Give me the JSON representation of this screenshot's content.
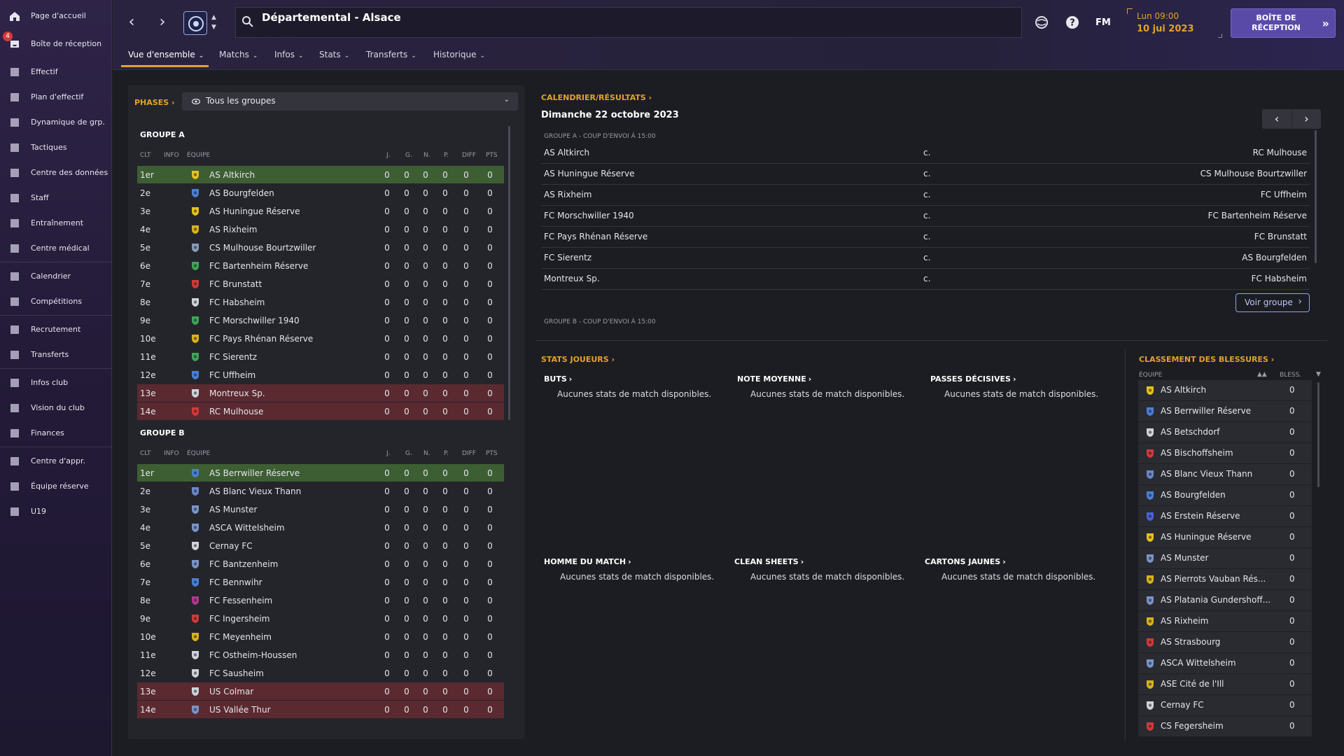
{
  "sidebar": {
    "items": [
      {
        "label": "Page d'accueil",
        "icon": "home-icon"
      },
      {
        "label": "Boîte de réception",
        "icon": "inbox-icon",
        "badge": "4"
      },
      {
        "label": "Effectif",
        "icon": "shirt-icon"
      },
      {
        "label": "Plan d'effectif",
        "icon": "clipboard-icon"
      },
      {
        "label": "Dynamique de grp.",
        "icon": "group-dynamics-icon"
      },
      {
        "label": "Tactiques",
        "icon": "tactics-icon"
      },
      {
        "label": "Centre des données",
        "icon": "data-hub-icon"
      },
      {
        "label": "Staff",
        "icon": "staff-icon"
      },
      {
        "label": "Entraînement",
        "icon": "training-icon"
      },
      {
        "label": "Centre médical",
        "icon": "medical-icon"
      },
      {
        "label": "Calendrier",
        "icon": "calendar-icon"
      },
      {
        "label": "Compétitions",
        "icon": "trophy-icon"
      },
      {
        "label": "Recrutement",
        "icon": "scouting-icon"
      },
      {
        "label": "Transferts",
        "icon": "transfers-icon"
      },
      {
        "label": "Infos club",
        "icon": "club-info-icon"
      },
      {
        "label": "Vision du club",
        "icon": "club-vision-icon"
      },
      {
        "label": "Finances",
        "icon": "finances-icon"
      },
      {
        "label": "Centre d'appr.",
        "icon": "youth-center-icon"
      },
      {
        "label": "Équipe réserve",
        "icon": "reserve-team-icon"
      },
      {
        "label": "U19",
        "icon": "u19-icon"
      }
    ]
  },
  "header": {
    "title": "Départemental - Alsace",
    "tabs": [
      "Vue d'ensemble",
      "Matchs",
      "Infos",
      "Stats",
      "Transferts",
      "Historique"
    ],
    "fm_label": "FM",
    "date_day": "Lun 09:00",
    "date_full": "10 jui 2023",
    "inbox_button": "BOÎTE DE RÉCEPTION"
  },
  "standings": {
    "phases_label": "PHASES",
    "filter_value": "Tous les groupes",
    "columns": [
      "CLT",
      "INFO",
      "ÉQUIPE",
      "J.",
      "G.",
      "N.",
      "P.",
      "DIFF",
      "PTS"
    ],
    "groups": [
      {
        "title": "GROUPE A",
        "rows": [
          {
            "pos": "1er",
            "team": "AS Altkirch",
            "stats": [
              "0",
              "0",
              "0",
              "0",
              "0",
              "0"
            ],
            "zone": "green",
            "crest": "#e8c21a"
          },
          {
            "pos": "2e",
            "team": "AS Bourgfelden",
            "stats": [
              "0",
              "0",
              "0",
              "0",
              "0",
              "0"
            ],
            "zone": "",
            "crest": "#4b7fd6"
          },
          {
            "pos": "3e",
            "team": "AS Huningue Réserve",
            "stats": [
              "0",
              "0",
              "0",
              "0",
              "0",
              "0"
            ],
            "zone": "",
            "crest": "#e8c21a"
          },
          {
            "pos": "4e",
            "team": "AS Rixheim",
            "stats": [
              "0",
              "0",
              "0",
              "0",
              "0",
              "0"
            ],
            "zone": "",
            "crest": "#d9b21c"
          },
          {
            "pos": "5e",
            "team": "CS Mulhouse Bourtzwiller",
            "stats": [
              "0",
              "0",
              "0",
              "0",
              "0",
              "0"
            ],
            "zone": "",
            "crest": "#8b9bb8"
          },
          {
            "pos": "6e",
            "team": "FC Bartenheim Réserve",
            "stats": [
              "0",
              "0",
              "0",
              "0",
              "0",
              "0"
            ],
            "zone": "",
            "crest": "#3fa55a"
          },
          {
            "pos": "7e",
            "team": "FC Brunstatt",
            "stats": [
              "0",
              "0",
              "0",
              "0",
              "0",
              "0"
            ],
            "zone": "",
            "crest": "#d23a3a"
          },
          {
            "pos": "8e",
            "team": "FC Habsheim",
            "stats": [
              "0",
              "0",
              "0",
              "0",
              "0",
              "0"
            ],
            "zone": "",
            "crest": "#cfd3da"
          },
          {
            "pos": "9e",
            "team": "FC Morschwiller 1940",
            "stats": [
              "0",
              "0",
              "0",
              "0",
              "0",
              "0"
            ],
            "zone": "",
            "crest": "#3fa55a"
          },
          {
            "pos": "10e",
            "team": "FC Pays Rhénan Réserve",
            "stats": [
              "0",
              "0",
              "0",
              "0",
              "0",
              "0"
            ],
            "zone": "",
            "crest": "#d9b21c"
          },
          {
            "pos": "11e",
            "team": "FC Sierentz",
            "stats": [
              "0",
              "0",
              "0",
              "0",
              "0",
              "0"
            ],
            "zone": "",
            "crest": "#3fa55a"
          },
          {
            "pos": "12e",
            "team": "FC Uffheim",
            "stats": [
              "0",
              "0",
              "0",
              "0",
              "0",
              "0"
            ],
            "zone": "",
            "crest": "#4b7fd6"
          },
          {
            "pos": "13e",
            "team": "Montreux Sp.",
            "stats": [
              "0",
              "0",
              "0",
              "0",
              "0",
              "0"
            ],
            "zone": "red",
            "crest": "#cfd3da"
          },
          {
            "pos": "14e",
            "team": "RC Mulhouse",
            "stats": [
              "0",
              "0",
              "0",
              "0",
              "0",
              "0"
            ],
            "zone": "red",
            "crest": "#d23a3a"
          }
        ]
      },
      {
        "title": "GROUPE B",
        "rows": [
          {
            "pos": "1er",
            "team": "AS Berrwiller Réserve",
            "stats": [
              "0",
              "0",
              "0",
              "0",
              "0",
              "0"
            ],
            "zone": "green",
            "crest": "#4b7fd6"
          },
          {
            "pos": "2e",
            "team": "AS Blanc Vieux Thann",
            "stats": [
              "0",
              "0",
              "0",
              "0",
              "0",
              "0"
            ],
            "zone": "",
            "crest": "#6b86c9"
          },
          {
            "pos": "3e",
            "team": "AS Munster",
            "stats": [
              "0",
              "0",
              "0",
              "0",
              "0",
              "0"
            ],
            "zone": "",
            "crest": "#7a94c8"
          },
          {
            "pos": "4e",
            "team": "ASCA Wittelsheim",
            "stats": [
              "0",
              "0",
              "0",
              "0",
              "0",
              "0"
            ],
            "zone": "",
            "crest": "#7a94c8"
          },
          {
            "pos": "5e",
            "team": "Cernay FC",
            "stats": [
              "0",
              "0",
              "0",
              "0",
              "0",
              "0"
            ],
            "zone": "",
            "crest": "#cfd3da"
          },
          {
            "pos": "6e",
            "team": "FC Bantzenheim",
            "stats": [
              "0",
              "0",
              "0",
              "0",
              "0",
              "0"
            ],
            "zone": "",
            "crest": "#7a94c8"
          },
          {
            "pos": "7e",
            "team": "FC Bennwihr",
            "stats": [
              "0",
              "0",
              "0",
              "0",
              "0",
              "0"
            ],
            "zone": "",
            "crest": "#4b7fd6"
          },
          {
            "pos": "8e",
            "team": "FC Fessenheim",
            "stats": [
              "0",
              "0",
              "0",
              "0",
              "0",
              "0"
            ],
            "zone": "",
            "crest": "#b03a8a"
          },
          {
            "pos": "9e",
            "team": "FC Ingersheim",
            "stats": [
              "0",
              "0",
              "0",
              "0",
              "0",
              "0"
            ],
            "zone": "",
            "crest": "#d23a3a"
          },
          {
            "pos": "10e",
            "team": "FC Meyenheim",
            "stats": [
              "0",
              "0",
              "0",
              "0",
              "0",
              "0"
            ],
            "zone": "",
            "crest": "#d9b21c"
          },
          {
            "pos": "11e",
            "team": "FC Ostheim-Houssen",
            "stats": [
              "0",
              "0",
              "0",
              "0",
              "0",
              "0"
            ],
            "zone": "",
            "crest": "#cfd3da"
          },
          {
            "pos": "12e",
            "team": "FC Sausheim",
            "stats": [
              "0",
              "0",
              "0",
              "0",
              "0",
              "0"
            ],
            "zone": "",
            "crest": "#cfd3da"
          },
          {
            "pos": "13e",
            "team": "US Colmar",
            "stats": [
              "0",
              "0",
              "0",
              "0",
              "0",
              "0"
            ],
            "zone": "red",
            "crest": "#cfd3da"
          },
          {
            "pos": "14e",
            "team": "US Vallée Thur",
            "stats": [
              "0",
              "0",
              "0",
              "0",
              "0",
              "0"
            ],
            "zone": "red",
            "crest": "#7a94c8"
          }
        ]
      }
    ]
  },
  "fixtures": {
    "header": "CALENDRIER/RÉSULTATS",
    "date": "Dimanche 22 octobre 2023",
    "group_a_label": "GROUPE A - COUP D'ENVOI À 15:00",
    "group_b_label": "GROUPE B - COUP D'ENVOI À 15:00",
    "vs": "c.",
    "matches": [
      {
        "home": "AS Altkirch",
        "away": "RC Mulhouse"
      },
      {
        "home": "AS Huningue Réserve",
        "away": "CS Mulhouse Bourtzwiller"
      },
      {
        "home": "AS Rixheim",
        "away": "FC Uffheim"
      },
      {
        "home": "FC Morschwiller 1940",
        "away": "FC Bartenheim Réserve"
      },
      {
        "home": "FC Pays Rhénan Réserve",
        "away": "FC Brunstatt"
      },
      {
        "home": "FC Sierentz",
        "away": "AS Bourgfelden"
      },
      {
        "home": "Montreux Sp.",
        "away": "FC Habsheim"
      }
    ],
    "view_group_button": "Voir groupe"
  },
  "player_stats": {
    "header": "STATS JOUEURS",
    "empty_text": "Aucunes stats de match disponibles.",
    "categories": [
      "BUTS",
      "NOTE MOYENNE",
      "PASSES DÉCISIVES",
      "HOMME DU MATCH",
      "CLEAN SHEETS",
      "CARTONS JAUNES"
    ]
  },
  "injuries": {
    "header": "CLASSEMENT DES BLESSURES",
    "col_team": "ÉQUIPE",
    "col_injuries": "BLESS.",
    "rows": [
      {
        "team": "AS Altkirch",
        "count": "0",
        "crest": "#e8c21a"
      },
      {
        "team": "AS Berrwiller Réserve",
        "count": "0",
        "crest": "#4b7fd6"
      },
      {
        "team": "AS Betschdorf",
        "count": "0",
        "crest": "#cfd3da"
      },
      {
        "team": "AS Bischoffsheim",
        "count": "0",
        "crest": "#d23a3a"
      },
      {
        "team": "AS Blanc Vieux Thann",
        "count": "0",
        "crest": "#6b86c9"
      },
      {
        "team": "AS Bourgfelden",
        "count": "0",
        "crest": "#4b7fd6"
      },
      {
        "team": "AS Erstein Réserve",
        "count": "0",
        "crest": "#4b62d6"
      },
      {
        "team": "AS Huningue Réserve",
        "count": "0",
        "crest": "#e8c21a"
      },
      {
        "team": "AS Munster",
        "count": "0",
        "crest": "#7a94c8"
      },
      {
        "team": "AS Pierrots Vauban Rés...",
        "count": "0",
        "crest": "#d9b21c"
      },
      {
        "team": "AS Platania Gundershoff...",
        "count": "0",
        "crest": "#7a94c8"
      },
      {
        "team": "AS Rixheim",
        "count": "0",
        "crest": "#d9b21c"
      },
      {
        "team": "AS Strasbourg",
        "count": "0",
        "crest": "#d23a3a"
      },
      {
        "team": "ASCA Wittelsheim",
        "count": "0",
        "crest": "#7a94c8"
      },
      {
        "team": "ASE Cité de l'Ill",
        "count": "0",
        "crest": "#d9b21c"
      },
      {
        "team": "Cernay FC",
        "count": "0",
        "crest": "#cfd3da"
      },
      {
        "team": "CS Fegersheim",
        "count": "0",
        "crest": "#d23a3a"
      }
    ]
  }
}
